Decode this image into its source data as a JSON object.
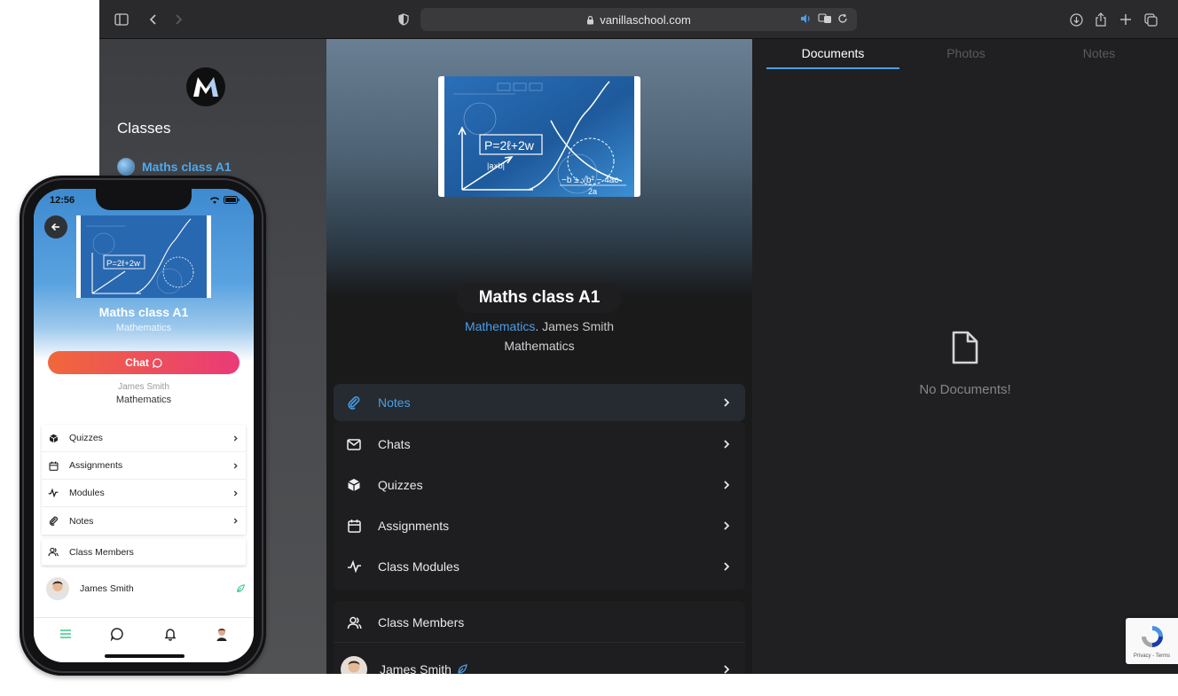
{
  "browser": {
    "url": "vanillaschool.com"
  },
  "sidebar": {
    "logo_letter": "M",
    "heading": "Classes",
    "active_class": "Maths class A1"
  },
  "class": {
    "title": "Maths class A1",
    "subject": "Mathematics",
    "separator": ". ",
    "teacher": "James Smith",
    "subject_line": "Mathematics"
  },
  "board_image": {
    "formula1": "P=2ℓ+2w",
    "formula2": "−b ± √b² − 4ac",
    "formula3": "2a",
    "formula4": "|a×b|"
  },
  "menu": {
    "items": [
      {
        "label": "Notes",
        "icon": "paperclip-icon",
        "active": true
      },
      {
        "label": "Chats",
        "icon": "mail-icon"
      },
      {
        "label": "Quizzes",
        "icon": "cube-icon"
      },
      {
        "label": "Assignments",
        "icon": "calendar-icon"
      },
      {
        "label": "Class Modules",
        "icon": "activity-icon"
      }
    ],
    "members_label": "Class Members",
    "member_name": "James Smith"
  },
  "right_panel": {
    "tabs": [
      "Documents",
      "Photos",
      "Notes"
    ],
    "active_tab": "Documents",
    "empty_text": "No Documents!"
  },
  "recaptcha": {
    "text": "Privacy - Terms"
  },
  "phone": {
    "time": "12:56",
    "title": "Maths class A1",
    "subject": "Mathematics",
    "chat_label": "Chat",
    "teacher": "James Smith",
    "subject_line": "Mathematics",
    "menu": [
      "Quizzes",
      "Assignments",
      "Modules",
      "Notes"
    ],
    "members_label": "Class Members",
    "member_name": "James Smith"
  },
  "colors": {
    "accent_blue": "#4a9ee8",
    "chat_gradient_start": "#f0673b",
    "chat_gradient_end": "#ea3a78",
    "leaf_green": "#3ec98a"
  }
}
